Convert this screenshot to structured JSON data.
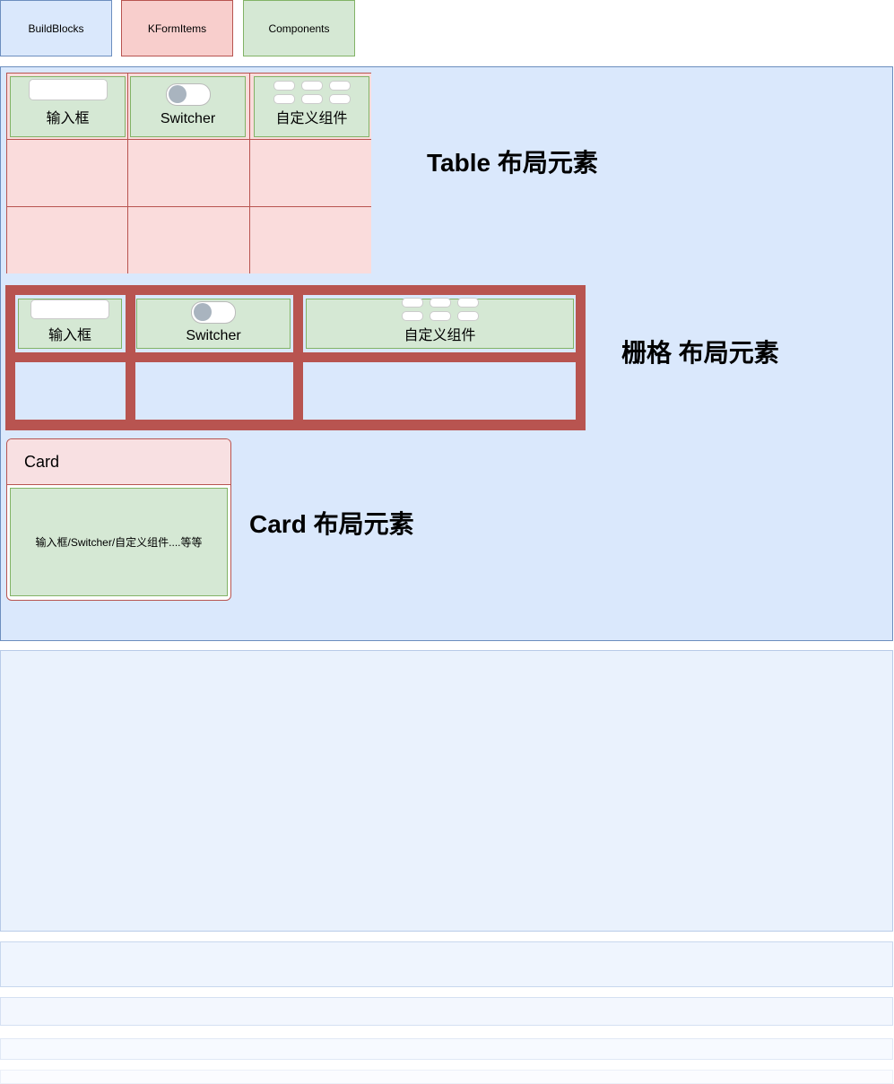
{
  "legend": {
    "build_blocks": "BuildBlocks",
    "kform_items": "KFormItems",
    "components": "Components"
  },
  "table_section": {
    "title": "Table 布局元素",
    "cells": [
      "输入框",
      "Switcher",
      "自定义组件"
    ]
  },
  "grid_section": {
    "title": "栅格 布局元素",
    "cells": [
      "输入框",
      "Switcher",
      "自定义组件"
    ]
  },
  "card_section": {
    "title": "Card 布局元素",
    "card_header": "Card",
    "card_body": "输入框/Switcher/自定义组件....等等"
  },
  "colors": {
    "blue_fill": "#dae8fc",
    "blue_stroke": "#6c8ebf",
    "red_fill": "#f8cecc",
    "red_stroke": "#b85450",
    "green_fill": "#d5e8d4",
    "green_stroke": "#82b366"
  }
}
